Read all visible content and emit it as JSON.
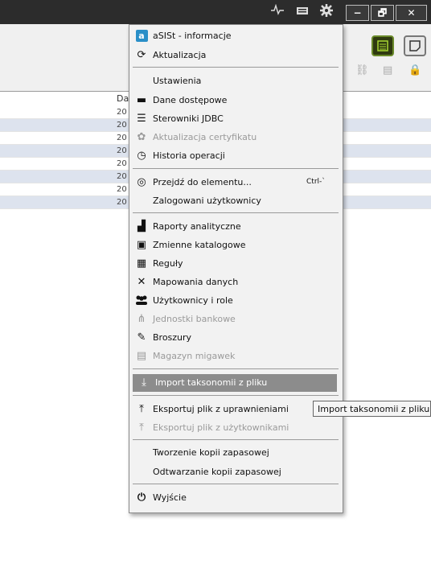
{
  "titlebar": {
    "icons": [
      "pulse-icon",
      "keyboard-icon",
      "gear-icon"
    ],
    "window_buttons": {
      "minimize": "−",
      "restore": "🗗",
      "close": "✕"
    }
  },
  "table": {
    "header": "Da",
    "cells": [
      "20",
      "20",
      "20",
      "20",
      "20",
      "20",
      "20",
      "20"
    ]
  },
  "menu": {
    "items": [
      {
        "label": "aSISt - informacje",
        "icon": "asist-logo-icon",
        "glyph": "a",
        "disabled": false
      },
      {
        "label": "Aktualizacja",
        "icon": "update-icon",
        "glyph": "⟳",
        "disabled": false
      },
      {
        "label": "Ustawienia",
        "icon": "",
        "glyph": "",
        "disabled": false
      },
      {
        "label": "Dane dostępowe",
        "icon": "briefcase-icon",
        "glyph": "▬",
        "disabled": false
      },
      {
        "label": "Sterowniki JDBC",
        "icon": "database-icon",
        "glyph": "☰",
        "disabled": false
      },
      {
        "label": "Aktualizacja certyfikatu",
        "icon": "certificate-icon",
        "glyph": "✿",
        "disabled": true
      },
      {
        "label": "Historia operacji",
        "icon": "history-icon",
        "glyph": "◷",
        "disabled": false
      },
      {
        "label": "Przejdź do elementu...",
        "icon": "goto-icon",
        "glyph": "◎",
        "shortcut": "Ctrl-`",
        "disabled": false
      },
      {
        "label": "Zalogowani użytkownicy",
        "icon": "",
        "glyph": "",
        "disabled": false
      },
      {
        "label": "Raporty analityczne",
        "icon": "chart-icon",
        "glyph": "▟",
        "disabled": false
      },
      {
        "label": "Zmienne katalogowe",
        "icon": "catalog-variables-icon",
        "glyph": "▣",
        "disabled": false
      },
      {
        "label": "Reguły",
        "icon": "calculator-icon",
        "glyph": "▦",
        "disabled": false
      },
      {
        "label": "Mapowania danych",
        "icon": "mapping-icon",
        "glyph": "✕",
        "disabled": false
      },
      {
        "label": "Użytkownicy i role",
        "icon": "users-icon",
        "glyph": "👥",
        "disabled": false
      },
      {
        "label": "Jednostki bankowe",
        "icon": "hierarchy-icon",
        "glyph": "⋔",
        "disabled": true
      },
      {
        "label": "Broszury",
        "icon": "pen-icon",
        "glyph": "✎",
        "disabled": false
      },
      {
        "label": "Magazyn migawek",
        "icon": "snapshot-icon",
        "glyph": "▤",
        "disabled": true
      },
      {
        "label": "Import taksonomii z pliku",
        "icon": "import-icon",
        "glyph": "⤓",
        "disabled": false,
        "highlighted": true
      },
      {
        "label": "Eksportuj plik z uprawnieniami",
        "icon": "export-icon",
        "glyph": "⤒",
        "disabled": false
      },
      {
        "label": "Eksportuj plik z użytkownikami",
        "icon": "export-users-icon",
        "glyph": "⤒",
        "disabled": true
      },
      {
        "label": "Tworzenie kopii zapasowej",
        "icon": "",
        "glyph": "",
        "disabled": false
      },
      {
        "label": "Odtwarzanie kopii zapasowej",
        "icon": "",
        "glyph": "",
        "disabled": false
      },
      {
        "label": "Wyjście",
        "icon": "power-icon",
        "glyph": "⏻",
        "disabled": false
      }
    ]
  },
  "tooltip": "Import taksonomii z pliku",
  "colors": {
    "highlight": "#8c8c8c",
    "titlebar": "#2c2c2c",
    "row_alt": "#dde3ee",
    "asist_blue": "#2a8fc8"
  }
}
